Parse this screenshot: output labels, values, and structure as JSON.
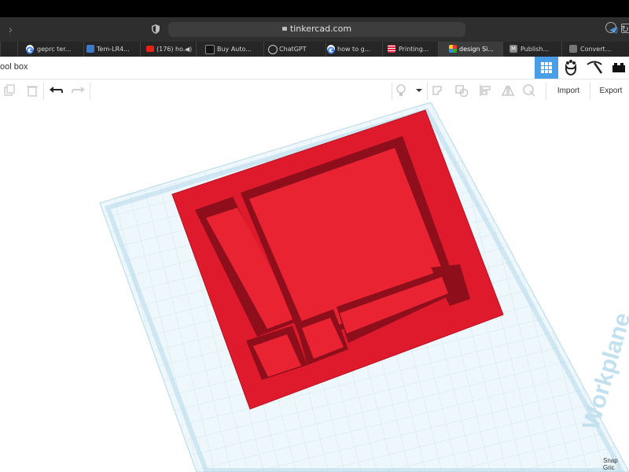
{
  "browser": {
    "url": "tinkercad.com",
    "tabs": [
      {
        "label": "geprc ter..."
      },
      {
        "label": "Tem-LR4..."
      },
      {
        "label": "(176) ho..."
      },
      {
        "label": "Buy Auto..."
      },
      {
        "label": "ChatGPT"
      },
      {
        "label": "how to g..."
      },
      {
        "label": "Printing..."
      },
      {
        "label": "design Si..."
      },
      {
        "label": "Publish..."
      },
      {
        "label": "Convert..."
      }
    ]
  },
  "app": {
    "title": "ool box",
    "import_label": "Import",
    "export_label": "Export"
  },
  "canvas": {
    "workplane_label": "Workplane",
    "snap_label": "Snap Gric"
  },
  "colors": {
    "accent": "#4a9ee8",
    "model_red": "#e01a2d",
    "grid": "#dff0f6"
  }
}
